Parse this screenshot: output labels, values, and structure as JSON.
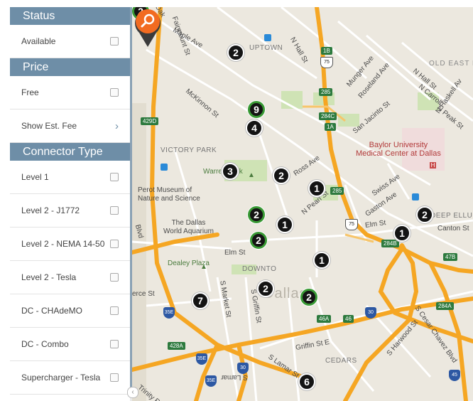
{
  "filters": {
    "status": {
      "header": "Status",
      "items": [
        {
          "label": "Available"
        }
      ]
    },
    "price": {
      "header": "Price",
      "items": [
        {
          "label": "Free"
        }
      ],
      "show_fee_label": "Show Est. Fee"
    },
    "connector": {
      "header": "Connector Type",
      "items": [
        {
          "label": "Level 1"
        },
        {
          "label": "Level 2 - J1772"
        },
        {
          "label": "Level 2 - NEMA 14-50"
        },
        {
          "label": "Level 2 - Tesla"
        },
        {
          "label": "DC - CHAdeMO"
        },
        {
          "label": "DC - Combo"
        },
        {
          "label": "Supercharger - Tesla"
        }
      ]
    }
  },
  "map": {
    "labels": {
      "uptown": "UPTOWN",
      "old_east": "OLD EAST L",
      "victory_park": "VICTORY PARK",
      "perot": "Perot Museum of\nNature and Science",
      "aquarium": "The Dallas\nWorld Aquarium",
      "warren": "Warren Park",
      "dealey": "Dealey Plaza",
      "downtown": "DOWNTO",
      "dallas": "Dallas",
      "baylor": "Baylor University\nMedical Center at Dallas",
      "cedars": "CEDARS",
      "deep_ellum": "DEEP ELLUM",
      "n_hall": "N Hall St",
      "munger": "Munger Ave",
      "roseland": "Roseland Ave",
      "n_haskell": "N Haskell Av",
      "n_carroll": "N Carroll",
      "n_peak": "N Peak St",
      "n_hall2": "N Hall St",
      "san_jacinto": "San Jacinto St",
      "fairmount": "Fairmount St",
      "maple": "Maple Ave",
      "mckinnon": "McKinnon St",
      "ross": "Ross Ave",
      "n_pearl": "N Pearl St",
      "swiss": "Swiss Ave",
      "gaston": "Gaston Ave",
      "elm": "Elm St",
      "elm2": "Elm St",
      "canton": "Canton St",
      "s_market": "S Market St",
      "s_griffin": "S Griffin St",
      "griffin": "Griffin St E",
      "s_lamar": "S Lamar St",
      "s_harwood": "S Harwood St",
      "s_cesar": "S Cesar Chavez Blvd",
      "commerce": "erce St",
      "trinity": "Trinity R",
      "hwy_blvd": "Blvd",
      "oak": "Oak",
      "lamar_n": "S Lamar"
    },
    "shields": {
      "s1b": "1B",
      "s75a": "75",
      "s285a": "285",
      "s284c": "284C",
      "s1a": "1A",
      "s429d": "429D",
      "s285b": "285",
      "s75b": "75",
      "s284b": "284B",
      "s47b": "47B",
      "s46a": "46A",
      "s46": "46",
      "s30a": "30",
      "s284a": "284A",
      "s35ea": "35E",
      "s428a": "428A",
      "s35eb": "35E",
      "s30b": "30",
      "s35ec": "35E",
      "s45": "45"
    },
    "markers": [
      {
        "count": "2",
        "style": "green"
      },
      {
        "count": "2",
        "style": "black"
      },
      {
        "count": "9",
        "style": "green"
      },
      {
        "count": "4",
        "style": "black"
      },
      {
        "count": "3",
        "style": "black"
      },
      {
        "count": "2",
        "style": "black"
      },
      {
        "count": "1",
        "style": "black"
      },
      {
        "count": "2",
        "style": "green"
      },
      {
        "count": "1",
        "style": "black"
      },
      {
        "count": "2",
        "style": "green"
      },
      {
        "count": "2",
        "style": "black"
      },
      {
        "count": "1",
        "style": "black"
      },
      {
        "count": "1",
        "style": "black"
      },
      {
        "count": "2",
        "style": "black"
      },
      {
        "count": "2",
        "style": "green"
      },
      {
        "count": "7",
        "style": "black"
      },
      {
        "count": "6",
        "style": "black"
      }
    ],
    "search_pin_icon": "magnifier-icon",
    "colors": {
      "highway": "#f5a623",
      "green_marker": "#3a9a35",
      "pin": "#f26b21",
      "header": "#6e8ea7"
    }
  }
}
